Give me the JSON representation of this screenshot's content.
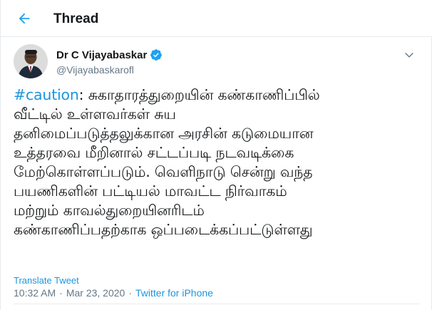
{
  "header": {
    "title": "Thread",
    "back_icon": "arrow-left-icon"
  },
  "author": {
    "display_name": "Dr C Vijayabaskar",
    "handle": "@Vijayabaskarofl",
    "verified": true,
    "avatar_icon": "profile-photo"
  },
  "tweet": {
    "hashtag": "#caution",
    "lines": [
      ": சுகாதாரத்துறையின் கண்காணிப்பில்",
      "வீட்டில் உள்ளவர்கள் சுய",
      "தனிமைப்படுத்தலுக்கான அரசின் கடுமையான",
      "உத்தரவை மீறினால் சட்டப்படி நடவடிக்கை",
      "மேற்கொள்ளப்படும். வெளிநாடு சென்று வந்த",
      "பயணிகளின் பட்டியல் மாவட்ட நிர்வாகம்",
      "மற்றும் காவல்துறையினரிடம்",
      "கண்காணிப்பதற்காக ஒப்படைக்கப்பட்டுள்ளது"
    ],
    "translate_label": "Translate Tweet",
    "time": "10:32 AM",
    "separator": "·",
    "date": "Mar 23, 2020",
    "source": "Twitter for iPhone"
  },
  "colors": {
    "accent": "#1b95e0",
    "text": "#14171a",
    "muted": "#657786"
  }
}
